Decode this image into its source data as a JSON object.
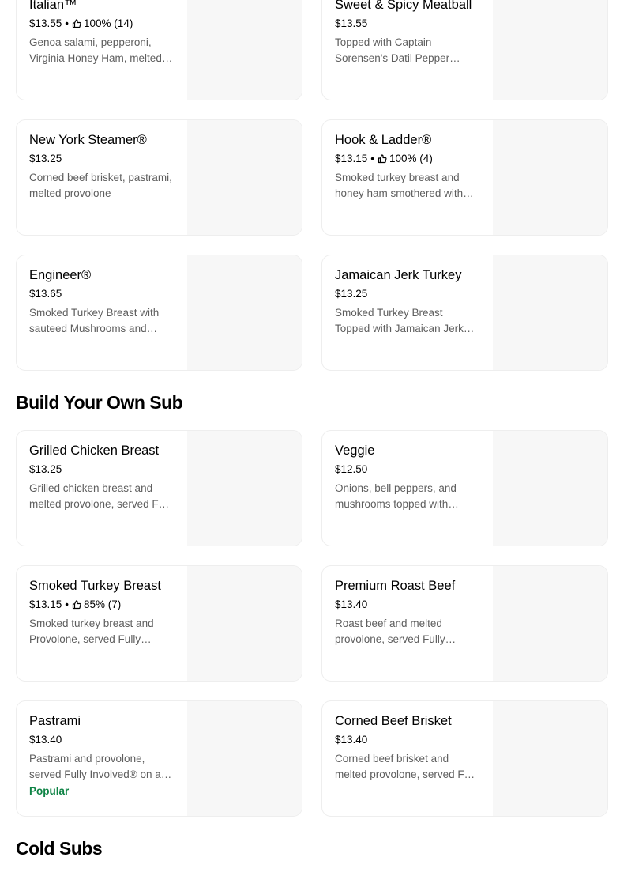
{
  "sections": [
    {
      "title": "",
      "items": [
        {
          "name": "Italian™",
          "price": "$13.55",
          "rating": "100% (14)",
          "description": "Genoa salami, pepperoni, Virginia Honey Ham, melted provolone"
        },
        {
          "name": "Sweet & Spicy Meatball",
          "price": "$13.55",
          "rating": "",
          "description": "Topped with Captain Sorensen's Datil Pepper Sauce"
        },
        {
          "name": "New York Steamer®",
          "price": "$13.25",
          "rating": "",
          "description": "Corned beef brisket, pastrami, melted provolone"
        },
        {
          "name": "Hook & Ladder®",
          "price": "$13.15",
          "rating": "100% (4)",
          "description": "Smoked turkey breast and honey ham smothered with melted Monterey Jack"
        },
        {
          "name": "Engineer®",
          "price": "$13.65",
          "rating": "",
          "description": "Smoked Turkey Breast with sauteed Mushrooms and Swiss"
        },
        {
          "name": "Jamaican Jerk Turkey",
          "price": "$13.25",
          "rating": "",
          "description": "Smoked Turkey Breast Topped with Jamaican Jerk Seasoning"
        }
      ]
    },
    {
      "title": "Build Your Own Sub",
      "items": [
        {
          "name": "Grilled Chicken Breast",
          "price": "$13.25",
          "rating": "",
          "description": "Grilled chicken breast and melted provolone, served Fully Involved®"
        },
        {
          "name": "Veggie",
          "price": "$12.50",
          "rating": "",
          "description": "Onions, bell peppers, and mushrooms topped with melted provolone"
        },
        {
          "name": "Smoked Turkey Breast",
          "price": "$13.15",
          "rating": "85% (7)",
          "description": "Smoked turkey breast and Provolone, served Fully Involved®"
        },
        {
          "name": "Premium Roast Beef",
          "price": "$13.40",
          "rating": "",
          "description": "Roast beef and melted provolone, served Fully Involved®"
        },
        {
          "name": "Pastrami",
          "price": "$13.40",
          "rating": "",
          "description": "Pastrami and provolone, served Fully Involved® on a toasted sub roll",
          "badge": "Popular"
        },
        {
          "name": "Corned Beef Brisket",
          "price": "$13.40",
          "rating": "",
          "description": "Corned beef brisket and melted provolone, served Fully Involved®"
        }
      ]
    },
    {
      "title": "Cold Subs",
      "items": []
    }
  ],
  "colors": {
    "badge": "#0e8345",
    "description": "#5e5e5e",
    "image_placeholder": "#f7f7f7"
  },
  "icons": {
    "rating": "thumbs-up-icon"
  }
}
